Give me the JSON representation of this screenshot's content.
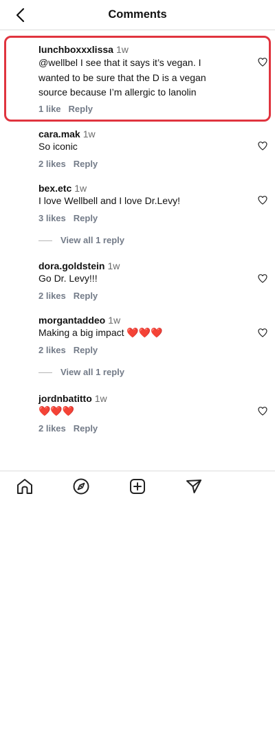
{
  "header": {
    "title": "Comments"
  },
  "comments": [
    {
      "username": "lunchboxxxlissa",
      "time": "1w",
      "lines": [
        "@wellbel I see that it says it’s vegan. I",
        "wanted to be sure that the D is a vegan",
        "source because I’m allergic to lanolin"
      ],
      "likes": "1 like",
      "reply": "Reply"
    },
    {
      "username": "cara.mak",
      "time": "1w",
      "lines": [
        "So iconic"
      ],
      "likes": "2 likes",
      "reply": "Reply"
    },
    {
      "username": "bex.etc",
      "time": "1w",
      "lines": [
        "I love Wellbell and I love Dr.Levy!"
      ],
      "likes": "3 likes",
      "reply": "Reply",
      "view_replies": "View all 1 reply"
    },
    {
      "username": "dora.goldstein",
      "time": "1w",
      "lines": [
        "Go Dr. Levy!!!"
      ],
      "likes": "2 likes",
      "reply": "Reply"
    },
    {
      "username": "morgantaddeo",
      "time": "1w",
      "lines": [
        "Making a big impact ❤️❤️❤️"
      ],
      "likes": "2 likes",
      "reply": "Reply",
      "view_replies": "View all 1 reply"
    },
    {
      "username": "jordnbatitto",
      "time": "1w",
      "lines": [
        "❤️❤️❤️"
      ],
      "likes": "2 likes",
      "reply": "Reply"
    }
  ],
  "nav": {
    "items": [
      "home-icon",
      "explore-icon",
      "create-icon",
      "send-icon"
    ]
  },
  "colors": {
    "highlight": "#e0343f",
    "meta": "#737b88",
    "divider": "#dcdcdc"
  }
}
